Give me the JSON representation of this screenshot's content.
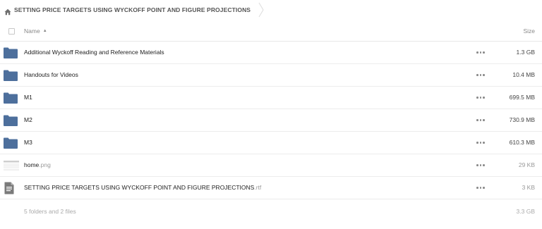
{
  "breadcrumb": {
    "path": "SETTING PRICE TARGETS USING WYCKOFF POINT AND FIGURE PROJECTIONS",
    "icon": "home-icon"
  },
  "header": {
    "name_label": "Name",
    "size_label": "Size",
    "sort": "ascending"
  },
  "files": [
    {
      "type": "folder",
      "name": "Additional Wyckoff Reading and Reference Materials",
      "ext": "",
      "size": "1.3 GB"
    },
    {
      "type": "folder",
      "name": "Handouts for Videos",
      "ext": "",
      "size": "10.4 MB"
    },
    {
      "type": "folder",
      "name": "M1",
      "ext": "",
      "size": "699.5 MB"
    },
    {
      "type": "folder",
      "name": "M2",
      "ext": "",
      "size": "730.9 MB"
    },
    {
      "type": "folder",
      "name": "M3",
      "ext": "",
      "size": "610.3 MB"
    },
    {
      "type": "image",
      "name": "home",
      "ext": ".png",
      "size": "29 KB"
    },
    {
      "type": "document",
      "name": "SETTING PRICE TARGETS USING WYCKOFF POINT AND FIGURE PROJECTIONS",
      "ext": ".rtf",
      "size": "3 KB"
    }
  ],
  "footer": {
    "summary": "5 folders and 2 files",
    "total": "3.3 GB"
  },
  "colors": {
    "folder": "#4d6f9c",
    "document": "#7a7a7a"
  }
}
